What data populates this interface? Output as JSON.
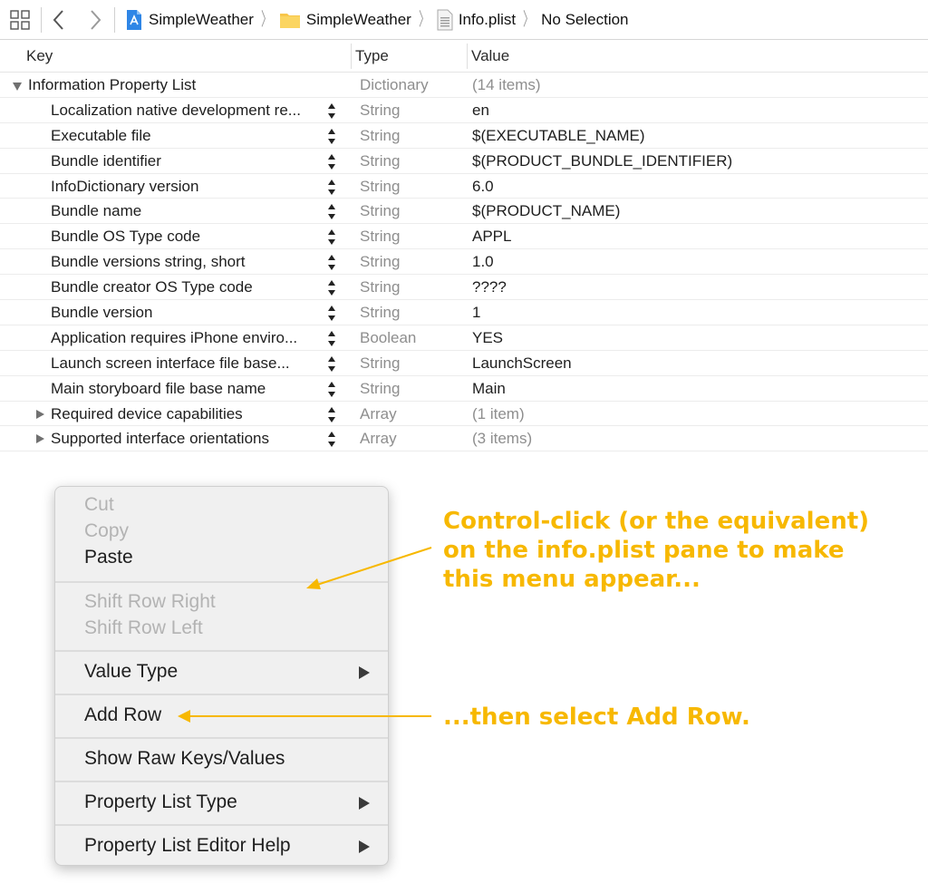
{
  "jumpbar": {
    "crumbs": [
      {
        "label": "SimpleWeather",
        "icon": "xcode-project-icon"
      },
      {
        "label": "SimpleWeather",
        "icon": "folder-icon"
      },
      {
        "label": "Info.plist",
        "icon": "plist-file-icon"
      },
      {
        "label": "No Selection",
        "icon": ""
      }
    ]
  },
  "table": {
    "headers": {
      "key": "Key",
      "type": "Type",
      "value": "Value"
    },
    "root": {
      "key": "Information Property List",
      "type": "Dictionary",
      "value": "(14 items)"
    },
    "rows": [
      {
        "key": "Localization native development re...",
        "type": "String",
        "value": "en"
      },
      {
        "key": "Executable file",
        "type": "String",
        "value": "$(EXECUTABLE_NAME)"
      },
      {
        "key": "Bundle identifier",
        "type": "String",
        "value": "$(PRODUCT_BUNDLE_IDENTIFIER)"
      },
      {
        "key": "InfoDictionary version",
        "type": "String",
        "value": "6.0"
      },
      {
        "key": "Bundle name",
        "type": "String",
        "value": "$(PRODUCT_NAME)"
      },
      {
        "key": "Bundle OS Type code",
        "type": "String",
        "value": "APPL"
      },
      {
        "key": "Bundle versions string, short",
        "type": "String",
        "value": "1.0"
      },
      {
        "key": "Bundle creator OS Type code",
        "type": "String",
        "value": "????"
      },
      {
        "key": "Bundle version",
        "type": "String",
        "value": "1"
      },
      {
        "key": "Application requires iPhone enviro...",
        "type": "Boolean",
        "value": "YES"
      },
      {
        "key": "Launch screen interface file base...",
        "type": "String",
        "value": "LaunchScreen"
      },
      {
        "key": "Main storyboard file base name",
        "type": "String",
        "value": "Main"
      },
      {
        "key": "Required device capabilities",
        "type": "Array",
        "value": "(1 item)"
      },
      {
        "key": "Supported interface orientations",
        "type": "Array",
        "value": "(3 items)"
      }
    ]
  },
  "menu": {
    "cut": "Cut",
    "copy": "Copy",
    "paste": "Paste",
    "shift_right": "Shift Row Right",
    "shift_left": "Shift Row Left",
    "value_type": "Value Type",
    "add_row": "Add Row",
    "show_raw": "Show Raw Keys/Values",
    "plist_type": "Property List Type",
    "editor_help": "Property List Editor Help"
  },
  "annotations": {
    "line1": "Control-click (or the equivalent)",
    "line2": "on the info.plist pane to make",
    "line3": "this menu appear...",
    "line4": "...then select Add Row.",
    "color": "#f7b800"
  }
}
